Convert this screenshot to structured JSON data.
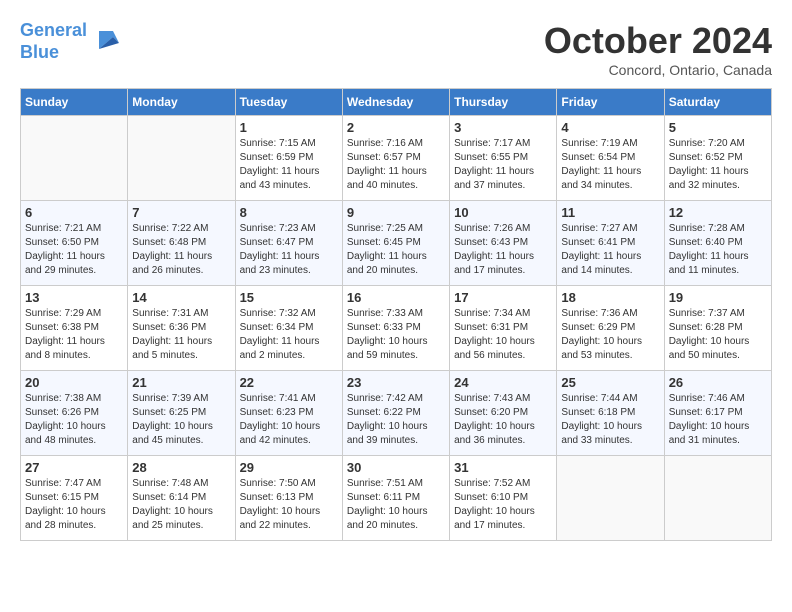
{
  "logo": {
    "line1": "General",
    "line2": "Blue"
  },
  "title": "October 2024",
  "location": "Concord, Ontario, Canada",
  "days_of_week": [
    "Sunday",
    "Monday",
    "Tuesday",
    "Wednesday",
    "Thursday",
    "Friday",
    "Saturday"
  ],
  "weeks": [
    [
      {
        "day": "",
        "info": ""
      },
      {
        "day": "",
        "info": ""
      },
      {
        "day": "1",
        "info": "Sunrise: 7:15 AM\nSunset: 6:59 PM\nDaylight: 11 hours\nand 43 minutes."
      },
      {
        "day": "2",
        "info": "Sunrise: 7:16 AM\nSunset: 6:57 PM\nDaylight: 11 hours\nand 40 minutes."
      },
      {
        "day": "3",
        "info": "Sunrise: 7:17 AM\nSunset: 6:55 PM\nDaylight: 11 hours\nand 37 minutes."
      },
      {
        "day": "4",
        "info": "Sunrise: 7:19 AM\nSunset: 6:54 PM\nDaylight: 11 hours\nand 34 minutes."
      },
      {
        "day": "5",
        "info": "Sunrise: 7:20 AM\nSunset: 6:52 PM\nDaylight: 11 hours\nand 32 minutes."
      }
    ],
    [
      {
        "day": "6",
        "info": "Sunrise: 7:21 AM\nSunset: 6:50 PM\nDaylight: 11 hours\nand 29 minutes."
      },
      {
        "day": "7",
        "info": "Sunrise: 7:22 AM\nSunset: 6:48 PM\nDaylight: 11 hours\nand 26 minutes."
      },
      {
        "day": "8",
        "info": "Sunrise: 7:23 AM\nSunset: 6:47 PM\nDaylight: 11 hours\nand 23 minutes."
      },
      {
        "day": "9",
        "info": "Sunrise: 7:25 AM\nSunset: 6:45 PM\nDaylight: 11 hours\nand 20 minutes."
      },
      {
        "day": "10",
        "info": "Sunrise: 7:26 AM\nSunset: 6:43 PM\nDaylight: 11 hours\nand 17 minutes."
      },
      {
        "day": "11",
        "info": "Sunrise: 7:27 AM\nSunset: 6:41 PM\nDaylight: 11 hours\nand 14 minutes."
      },
      {
        "day": "12",
        "info": "Sunrise: 7:28 AM\nSunset: 6:40 PM\nDaylight: 11 hours\nand 11 minutes."
      }
    ],
    [
      {
        "day": "13",
        "info": "Sunrise: 7:29 AM\nSunset: 6:38 PM\nDaylight: 11 hours\nand 8 minutes."
      },
      {
        "day": "14",
        "info": "Sunrise: 7:31 AM\nSunset: 6:36 PM\nDaylight: 11 hours\nand 5 minutes."
      },
      {
        "day": "15",
        "info": "Sunrise: 7:32 AM\nSunset: 6:34 PM\nDaylight: 11 hours\nand 2 minutes."
      },
      {
        "day": "16",
        "info": "Sunrise: 7:33 AM\nSunset: 6:33 PM\nDaylight: 10 hours\nand 59 minutes."
      },
      {
        "day": "17",
        "info": "Sunrise: 7:34 AM\nSunset: 6:31 PM\nDaylight: 10 hours\nand 56 minutes."
      },
      {
        "day": "18",
        "info": "Sunrise: 7:36 AM\nSunset: 6:29 PM\nDaylight: 10 hours\nand 53 minutes."
      },
      {
        "day": "19",
        "info": "Sunrise: 7:37 AM\nSunset: 6:28 PM\nDaylight: 10 hours\nand 50 minutes."
      }
    ],
    [
      {
        "day": "20",
        "info": "Sunrise: 7:38 AM\nSunset: 6:26 PM\nDaylight: 10 hours\nand 48 minutes."
      },
      {
        "day": "21",
        "info": "Sunrise: 7:39 AM\nSunset: 6:25 PM\nDaylight: 10 hours\nand 45 minutes."
      },
      {
        "day": "22",
        "info": "Sunrise: 7:41 AM\nSunset: 6:23 PM\nDaylight: 10 hours\nand 42 minutes."
      },
      {
        "day": "23",
        "info": "Sunrise: 7:42 AM\nSunset: 6:22 PM\nDaylight: 10 hours\nand 39 minutes."
      },
      {
        "day": "24",
        "info": "Sunrise: 7:43 AM\nSunset: 6:20 PM\nDaylight: 10 hours\nand 36 minutes."
      },
      {
        "day": "25",
        "info": "Sunrise: 7:44 AM\nSunset: 6:18 PM\nDaylight: 10 hours\nand 33 minutes."
      },
      {
        "day": "26",
        "info": "Sunrise: 7:46 AM\nSunset: 6:17 PM\nDaylight: 10 hours\nand 31 minutes."
      }
    ],
    [
      {
        "day": "27",
        "info": "Sunrise: 7:47 AM\nSunset: 6:15 PM\nDaylight: 10 hours\nand 28 minutes."
      },
      {
        "day": "28",
        "info": "Sunrise: 7:48 AM\nSunset: 6:14 PM\nDaylight: 10 hours\nand 25 minutes."
      },
      {
        "day": "29",
        "info": "Sunrise: 7:50 AM\nSunset: 6:13 PM\nDaylight: 10 hours\nand 22 minutes."
      },
      {
        "day": "30",
        "info": "Sunrise: 7:51 AM\nSunset: 6:11 PM\nDaylight: 10 hours\nand 20 minutes."
      },
      {
        "day": "31",
        "info": "Sunrise: 7:52 AM\nSunset: 6:10 PM\nDaylight: 10 hours\nand 17 minutes."
      },
      {
        "day": "",
        "info": ""
      },
      {
        "day": "",
        "info": ""
      }
    ]
  ]
}
